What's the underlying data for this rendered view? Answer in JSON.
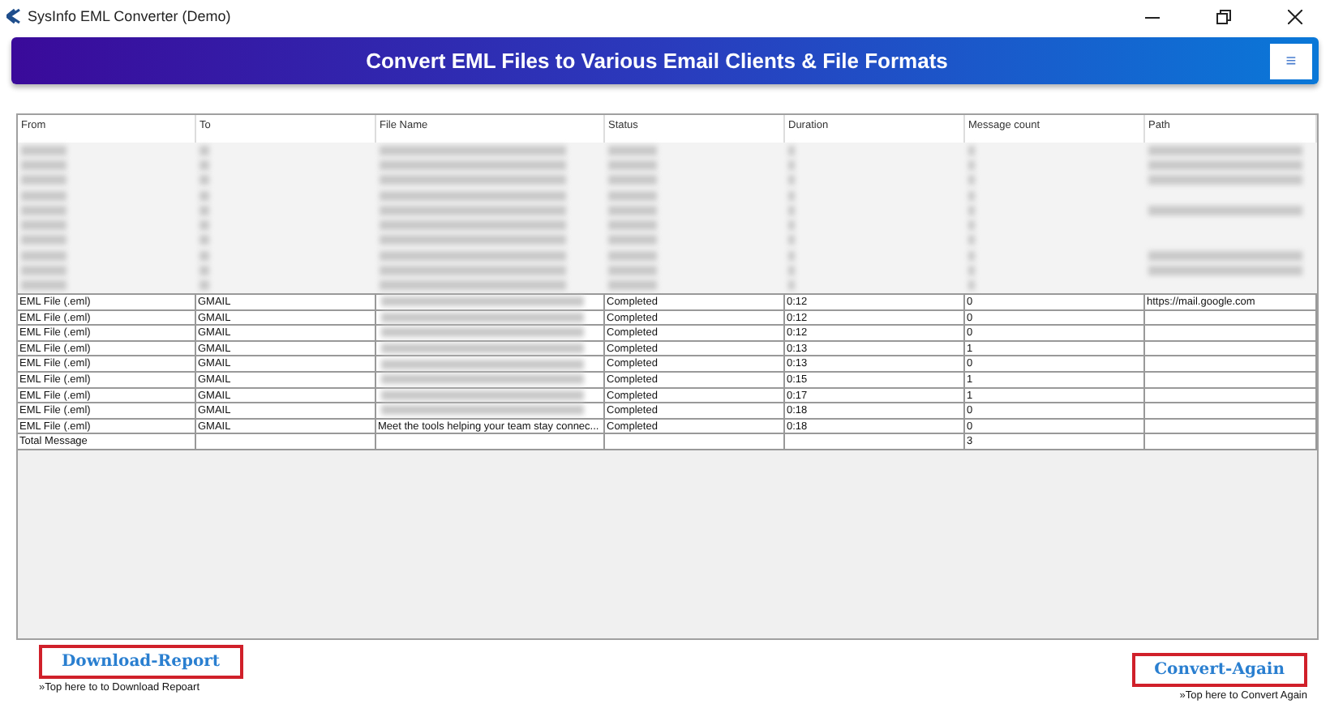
{
  "window": {
    "title": "SysInfo EML Converter (Demo)"
  },
  "banner": {
    "title": "Convert EML Files to Various Email Clients & File Formats",
    "menu_icon": "≡"
  },
  "table": {
    "columns": [
      "From",
      "To",
      "File Name",
      "Status",
      "Duration",
      "Message count",
      "Path"
    ],
    "blurred_rows": [
      {
        "path": true
      },
      {
        "path": true
      },
      {
        "path": true
      },
      {
        "path": false
      },
      {
        "path": true
      },
      {
        "path": false
      },
      {
        "path": false
      },
      {
        "path": true
      },
      {
        "path": true
      },
      {
        "path": false
      }
    ],
    "rows": [
      {
        "from": "EML File (.eml)",
        "to": "GMAIL",
        "file_name_blurred": true,
        "status": "Completed",
        "duration": "0:12",
        "count": "0",
        "path": "https://mail.google.com"
      },
      {
        "from": "EML File (.eml)",
        "to": "GMAIL",
        "file_name_blurred": true,
        "status": "Completed",
        "duration": "0:12",
        "count": "0"
      },
      {
        "from": "EML File (.eml)",
        "to": "GMAIL",
        "file_name_blurred": true,
        "status": "Completed",
        "duration": "0:12",
        "count": "0"
      },
      {
        "from": "EML File (.eml)",
        "to": "GMAIL",
        "file_name_blurred": true,
        "status": "Completed",
        "duration": "0:13",
        "count": "1"
      },
      {
        "from": "EML File (.eml)",
        "to": "GMAIL",
        "file_name_blurred": true,
        "status": "Completed",
        "duration": "0:13",
        "count": "0"
      },
      {
        "from": "EML File (.eml)",
        "to": "GMAIL",
        "file_name_blurred": true,
        "status": "Completed",
        "duration": "0:15",
        "count": "1"
      },
      {
        "from": "EML File (.eml)",
        "to": "GMAIL",
        "file_name_blurred": true,
        "status": "Completed",
        "duration": "0:17",
        "count": "1"
      },
      {
        "from": "EML File (.eml)",
        "to": "GMAIL",
        "file_name_blurred": true,
        "status": "Completed",
        "duration": "0:18",
        "count": "0"
      },
      {
        "from": "EML File (.eml)",
        "to": "GMAIL",
        "file_name_blurred": false,
        "file_name": "Meet the tools helping your team stay connec...",
        "status": "Completed",
        "duration": "0:18",
        "count": "0"
      }
    ],
    "total": {
      "label": "Total Message",
      "count": "3"
    }
  },
  "actions": [
    {
      "label": "Download-Report",
      "hint": "»Top here to to Download Repoart"
    },
    {
      "label": "Convert-Again",
      "hint": "»Top here to Convert Again"
    }
  ]
}
